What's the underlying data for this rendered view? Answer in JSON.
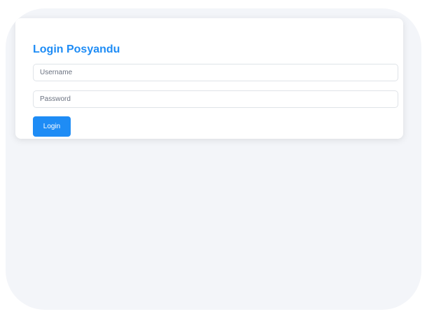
{
  "login": {
    "title": "Login Posyandu",
    "username": {
      "value": "",
      "placeholder": "Username"
    },
    "password": {
      "value": "",
      "placeholder": "Password"
    },
    "submit_label": "Login"
  },
  "colors": {
    "accent": "#1e8cf5",
    "page_background": "#f3f5f9",
    "card_background": "#ffffff",
    "input_border": "#dfe3e8"
  }
}
